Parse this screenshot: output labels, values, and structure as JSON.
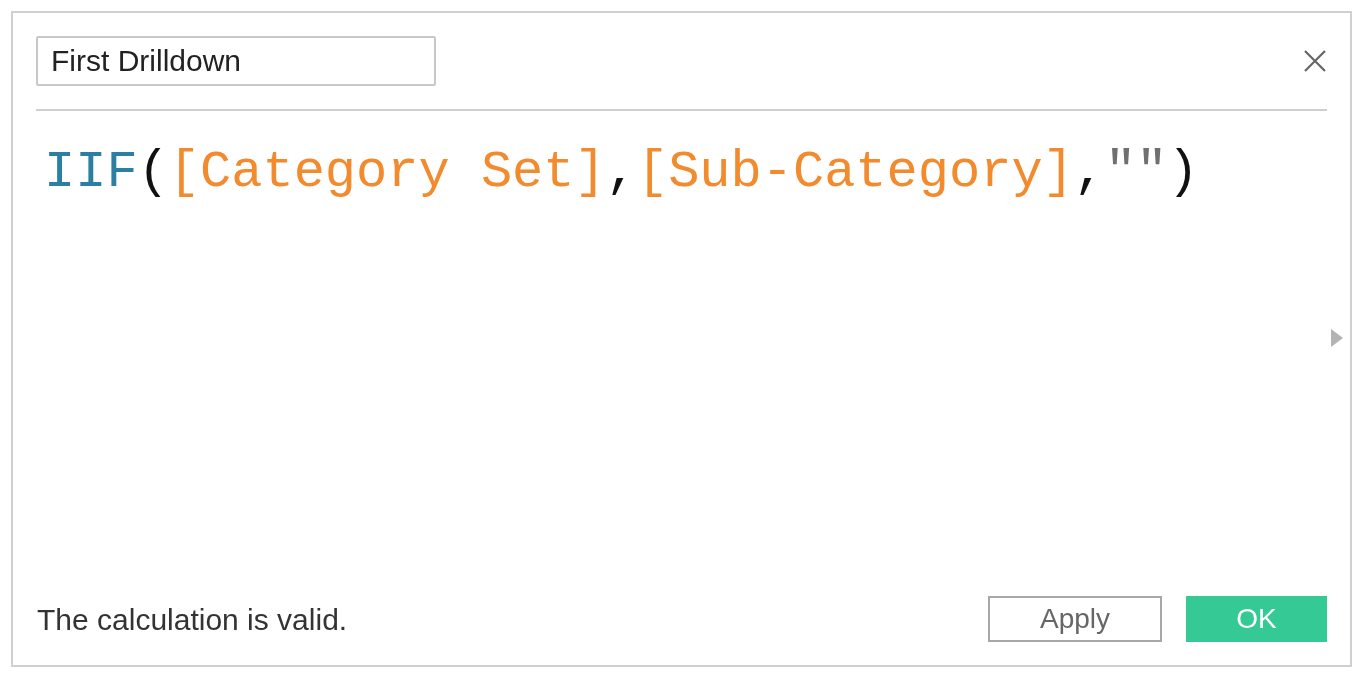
{
  "name_field": {
    "value": "First Drilldown"
  },
  "formula": [
    {
      "kind": "function",
      "text": "IIF"
    },
    {
      "kind": "punct",
      "text": "("
    },
    {
      "kind": "field",
      "text": "[Category Set]"
    },
    {
      "kind": "punct",
      "text": ","
    },
    {
      "kind": "field",
      "text": "[Sub-Category]"
    },
    {
      "kind": "punct",
      "text": ","
    },
    {
      "kind": "string",
      "text": "\"\""
    },
    {
      "kind": "punct",
      "text": ")"
    }
  ],
  "status": "The calculation is valid.",
  "buttons": [
    {
      "kind": "secondary",
      "label": "Apply"
    },
    {
      "kind": "primary",
      "label": "OK"
    }
  ]
}
